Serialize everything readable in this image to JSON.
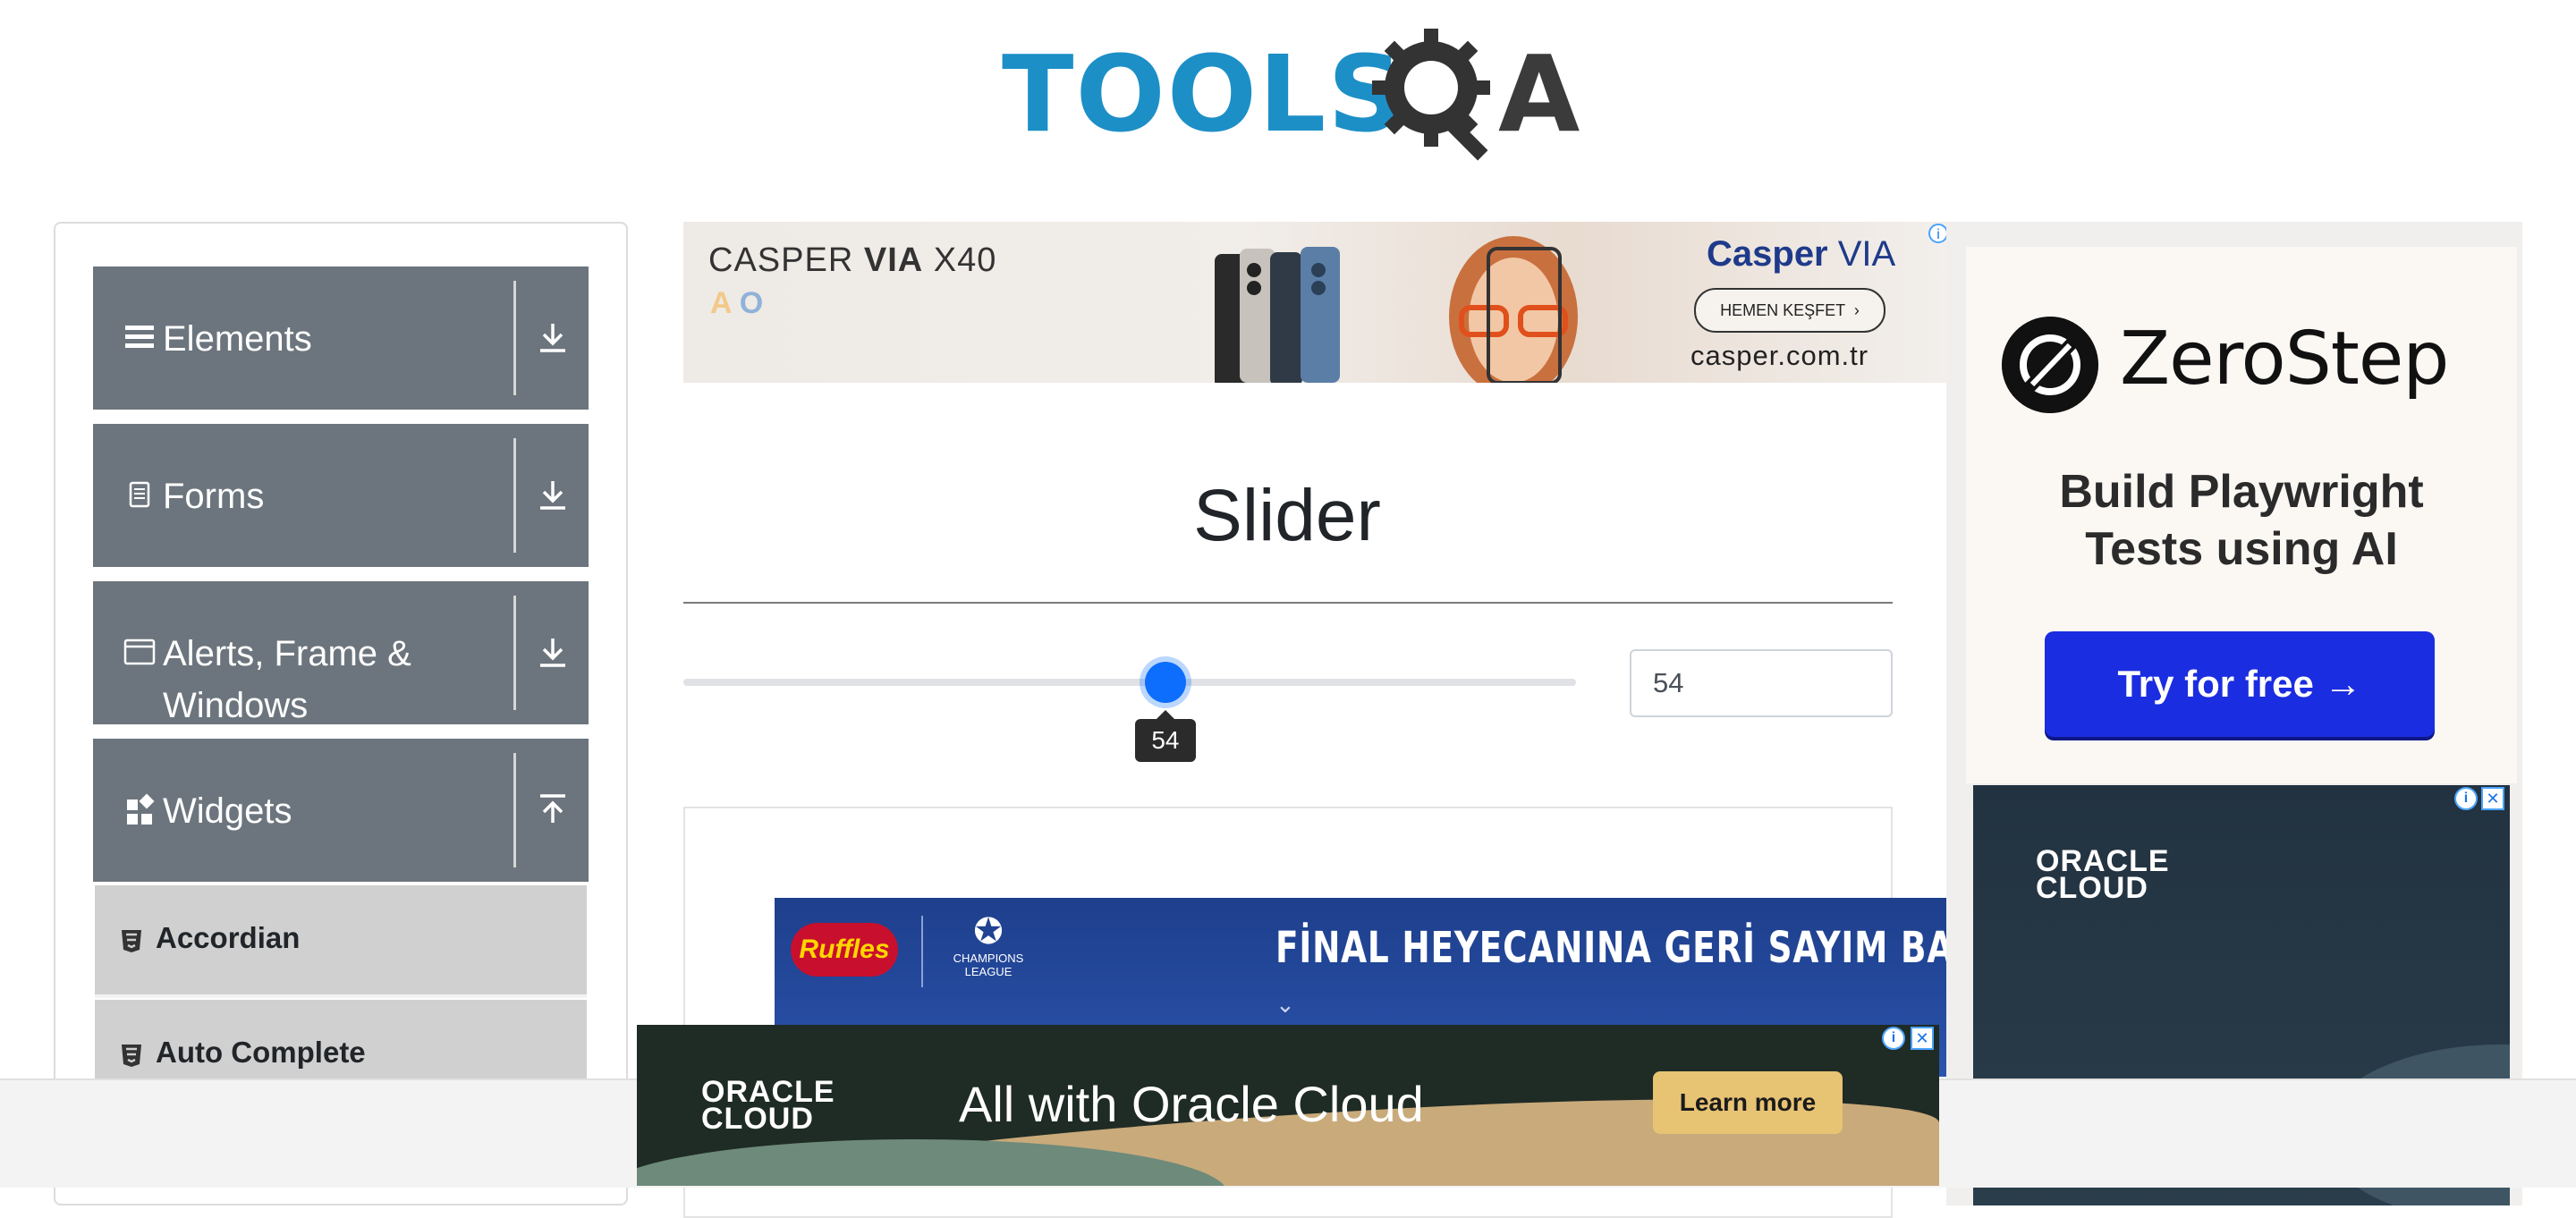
{
  "header": {
    "logo_text_left": "TOOLS",
    "logo_text_right": "A"
  },
  "sidebar": {
    "groups": [
      {
        "label": "Elements",
        "icon": "menu-lines-icon",
        "arrow": "download-icon"
      },
      {
        "label": "Forms",
        "icon": "document-icon",
        "arrow": "download-icon"
      },
      {
        "label": "Alerts, Frame & Windows",
        "icon": "window-icon",
        "arrow": "download-icon"
      },
      {
        "label": "Widgets",
        "icon": "widgets-grid-icon",
        "arrow": "upload-icon"
      }
    ],
    "widget_items": [
      {
        "label": "Accordian",
        "icon": "html5-icon"
      },
      {
        "label": "Auto Complete",
        "icon": "html5-icon"
      }
    ]
  },
  "ads": {
    "top": {
      "brand_line": "CASPER",
      "brand_bold": "VIA",
      "brand_model": "X40",
      "logo": "Casper",
      "logo_suffix": "VIA",
      "button": "HEMEN KEŞFET",
      "domain": "casper.com.tr",
      "info": "i"
    },
    "ruffles": {
      "logo": "Ruffles",
      "league_line1": "CHAMPIONS",
      "league_line2": "LEAGUE",
      "headline": "FİNAL HEYECANINA GERİ SAYIM BAŞLA",
      "chevron": "⌄"
    },
    "right": {
      "brand": "ZeroStep",
      "tagline_line1": "Build Playwright",
      "tagline_line2": "Tests using AI",
      "cta": "Try for free →",
      "oracle_line1": "ORACLE",
      "oracle_line2": "CLOUD",
      "info": "i",
      "close": "✕"
    },
    "bottom": {
      "oracle_line1": "ORACLE",
      "oracle_line2": "CLOUD",
      "message": "All with Oracle Cloud",
      "cta": "Learn more",
      "info": "i",
      "close": "✕"
    }
  },
  "main": {
    "title": "Slider",
    "slider": {
      "value": 54,
      "min": 0,
      "max": 100,
      "tooltip": "54"
    },
    "value_field": "54"
  },
  "colors": {
    "sidebar_group_bg": "#6c757d",
    "sidebar_item_bg": "#d0d0d0",
    "slider_thumb": "#0d6efd",
    "logo_blue": "#1d8fc7",
    "zerostep_cta": "#1b2de0"
  }
}
